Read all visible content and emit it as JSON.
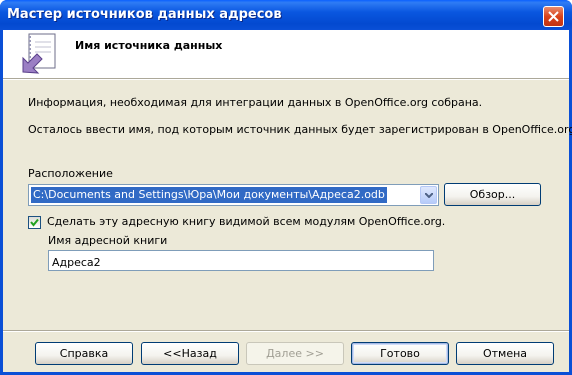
{
  "window": {
    "title": "Мастер источников данных адресов"
  },
  "header": {
    "title": "Имя источника данных"
  },
  "body": {
    "info_line1": "Информация, необходимая для интеграции данных в OpenOffice.org собрана.",
    "info_line2": "Осталось ввести имя, под которым источник данных будет зарегистрирован в OpenOffice.org.",
    "location_label": "Расположение",
    "location_value": "C:\\Documents and Settings\\Юра\\Мои документы\\Адреса2.odb",
    "browse_label": "Обзор...",
    "visible_checkbox_label": "Сделать эту адресную книгу видимой всем модулям OpenOffice.org.",
    "visible_checkbox_checked": true,
    "addressbook_name_label": "Имя адресной книги",
    "addressbook_name_value": "Адреса2"
  },
  "footer": {
    "help_label": "Справка",
    "back_label": "<<Назад",
    "next_label": "Далее >>",
    "finish_label": "Готово",
    "cancel_label": "Отмена"
  },
  "colors": {
    "titlebar": "#0a4fd6",
    "dialog_bg": "#ece9d8",
    "selection": "#316ac5",
    "close_button": "#d9431b"
  }
}
